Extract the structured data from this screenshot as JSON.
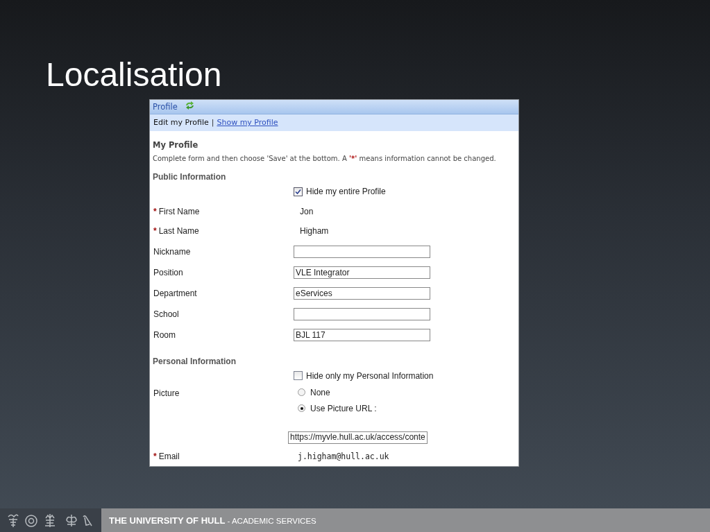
{
  "slide": {
    "title": "Localisation"
  },
  "profile": {
    "title": "Profile",
    "nav": {
      "current": "Edit my Profile",
      "separator": "|",
      "link": "Show my Profile"
    },
    "heading": "My Profile",
    "intro": "Complete form and then choose 'Save' at the bottom. A **'*'** means information cannot be changed.",
    "public": {
      "heading": "Public Information",
      "hide": {
        "label": "Hide my entire Profile",
        "checked": true
      },
      "fields": [
        {
          "mark": "*",
          "label": "First Name",
          "kind": "static",
          "value": "Jon"
        },
        {
          "mark": "*",
          "label": "Last Name",
          "kind": "static",
          "value": "Higham"
        },
        {
          "label": "Nickname",
          "kind": "input"
        },
        {
          "label": "Position",
          "kind": "input",
          "value": "VLE Integrator"
        },
        {
          "label": "Department",
          "kind": "input",
          "value": "eServices"
        },
        {
          "label": "School",
          "kind": "input"
        },
        {
          "label": "Room",
          "kind": "input",
          "value": "BJL 117"
        }
      ]
    },
    "personal": {
      "heading": "Personal Information",
      "hide": {
        "label": "Hide only my Personal Information",
        "checked": false
      },
      "picture": {
        "label": "Picture",
        "options": [
          {
            "label": "None",
            "selected": false
          },
          {
            "label": "Use Picture URL :",
            "selected": true
          }
        ],
        "url": "https://myvle.hull.ac.uk/access/conte"
      },
      "email": {
        "mark": "*",
        "label": "Email",
        "value": "j.higham@hull.ac.uk"
      }
    }
  },
  "footer": {
    "text": "**THE UNIVERSITY OF HULL** - ACADEMIC SERVICES"
  }
}
